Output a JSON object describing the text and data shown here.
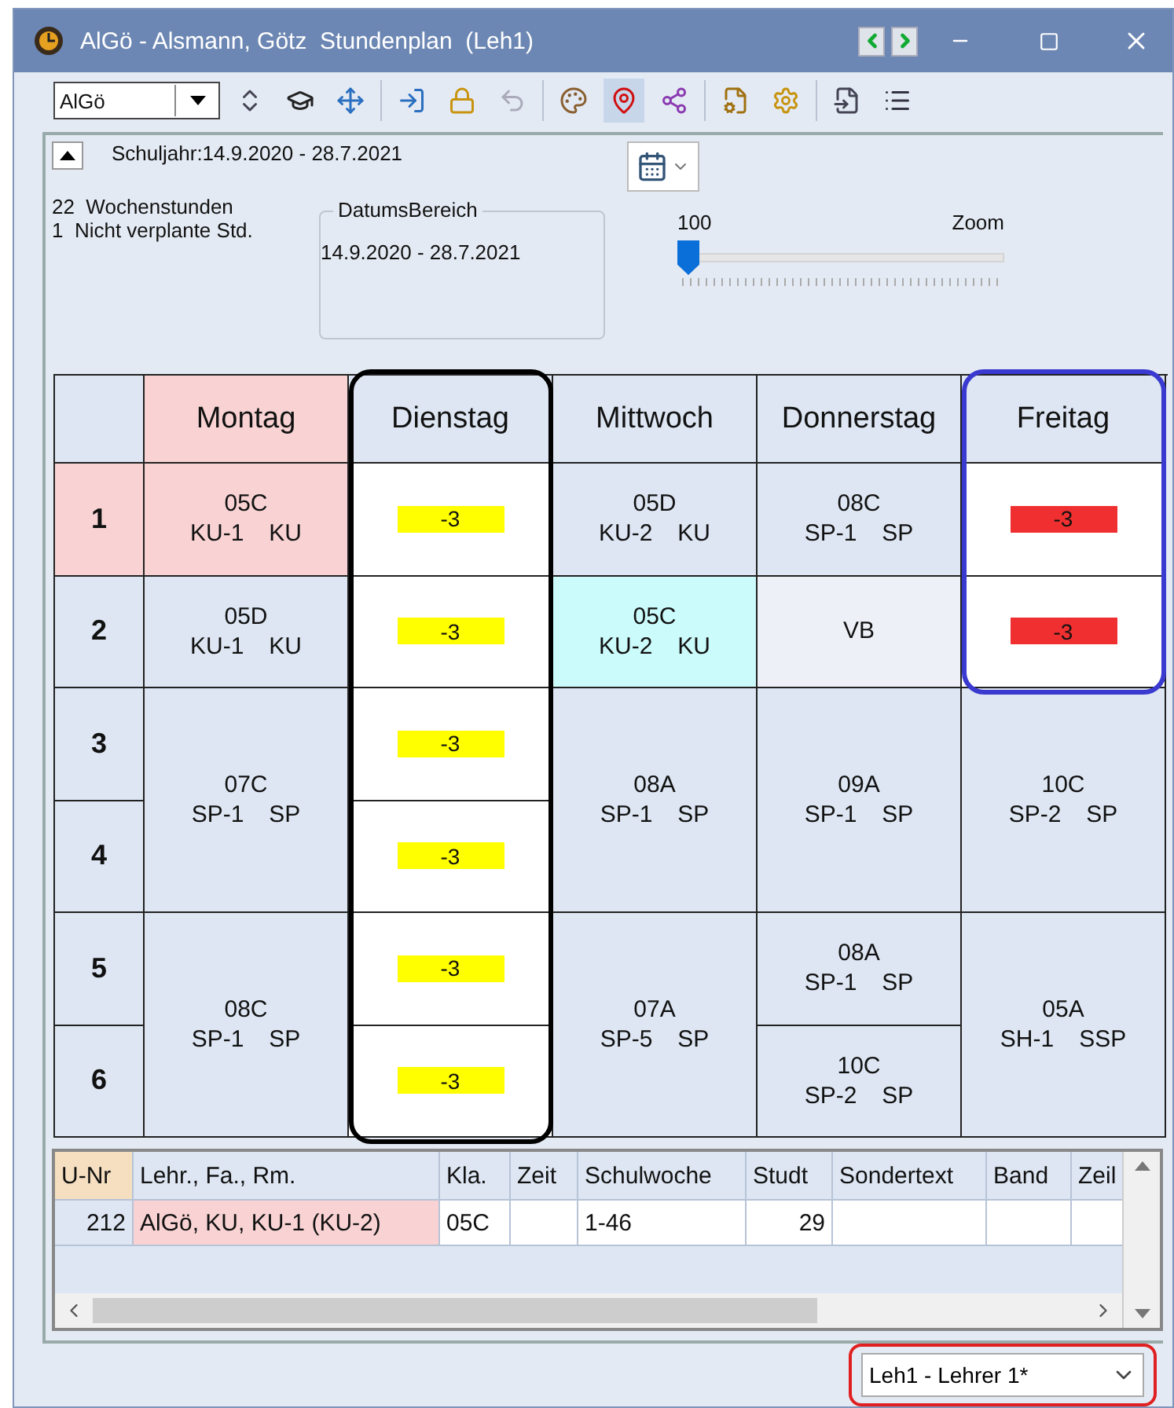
{
  "window": {
    "title": "AlGö - Alsmann, Götz  Stundenplan  (Leh1)"
  },
  "toolbar": {
    "element_field": "AlGö"
  },
  "info": {
    "school_year": "Schuljahr:14.9.2020 - 28.7.2021",
    "weekly_hours": "22  Wochenstunden",
    "unplanned": "1  Nicht verplante Std.",
    "date_range": {
      "legend": "DatumsBereich",
      "value": "14.9.2020 - 28.7.2021"
    },
    "zoom": {
      "value": "100",
      "label": "Zoom",
      "level": 0
    }
  },
  "periods": [
    {
      "label": "1",
      "color": "#f9d3d3"
    },
    {
      "label": "2",
      "color": "#dde6f2"
    },
    {
      "label": "3",
      "color": "#dde6f2"
    },
    {
      "label": "4",
      "color": "#dde6f2"
    },
    {
      "label": "5",
      "color": "#dde6f2"
    },
    {
      "label": "6",
      "color": "#dde6f2"
    }
  ],
  "days": [
    {
      "name": "Montag",
      "color": "#f9d3d3",
      "cells": [
        {
          "kind": "single",
          "color": "#f9d3d3",
          "class": "05C",
          "group": "KU-1",
          "subject": "KU"
        },
        {
          "kind": "single",
          "color": "#dde6f2",
          "class": "05D",
          "group": "KU-1",
          "subject": "KU"
        },
        {
          "kind": "double",
          "color": "#dde6f2",
          "class": "07C",
          "group": "SP-1",
          "subject": "SP"
        },
        {
          "kind": "double",
          "color": "#dde6f2",
          "class": "08C",
          "group": "SP-1",
          "subject": "SP"
        }
      ]
    },
    {
      "name": "Dienstag",
      "color": "#dde6f2",
      "outline": {
        "kind": "column",
        "color": "#000000"
      },
      "cells": [
        {
          "kind": "absence",
          "value": "-3",
          "color": "#ffff00"
        },
        {
          "kind": "absence",
          "value": "-3",
          "color": "#ffff00"
        },
        {
          "kind": "absence",
          "value": "-3",
          "color": "#ffff00"
        },
        {
          "kind": "absence",
          "value": "-3",
          "color": "#ffff00"
        },
        {
          "kind": "absence",
          "value": "-3",
          "color": "#ffff00"
        },
        {
          "kind": "absence",
          "value": "-3",
          "color": "#ffff00"
        }
      ]
    },
    {
      "name": "Mittwoch",
      "color": "#dde6f2",
      "cells": [
        {
          "kind": "single",
          "color": "#dde6f2",
          "class": "05D",
          "group": "KU-2",
          "subject": "KU"
        },
        {
          "kind": "single",
          "color": "#ccfbfb",
          "class": "05C",
          "group": "KU-2",
          "subject": "KU"
        },
        {
          "kind": "double",
          "color": "#dde6f2",
          "class": "08A",
          "group": "SP-1",
          "subject": "SP"
        },
        {
          "kind": "double",
          "color": "#dde6f2",
          "class": "07A",
          "group": "SP-5",
          "subject": "SP"
        }
      ]
    },
    {
      "name": "Donnerstag",
      "color": "#dde6f2",
      "cells": [
        {
          "kind": "single",
          "color": "#dde6f2",
          "class": "08C",
          "group": "SP-1",
          "subject": "SP"
        },
        {
          "kind": "single",
          "color": "#edf1f7",
          "class": "VB"
        },
        {
          "kind": "double",
          "color": "#dde6f2",
          "class": "09A",
          "group": "SP-1",
          "subject": "SP"
        },
        {
          "kind": "single",
          "color": "#dde6f2",
          "class": "08A",
          "group": "SP-1",
          "subject": "SP"
        },
        {
          "kind": "single",
          "color": "#dde6f2",
          "class": "10C",
          "group": "SP-2",
          "subject": "SP"
        }
      ]
    },
    {
      "name": "Freitag",
      "color": "#dde6f2",
      "outline": {
        "kind": "top",
        "color": "#3a3ad0"
      },
      "cells": [
        {
          "kind": "absence",
          "value": "-3",
          "color": "#f03030"
        },
        {
          "kind": "absence",
          "value": "-3",
          "color": "#f03030"
        },
        {
          "kind": "double",
          "color": "#dde6f2",
          "class": "10C",
          "group": "SP-2",
          "subject": "SP"
        },
        {
          "kind": "double",
          "color": "#dde6f2",
          "class": "05A",
          "group": "SH-1",
          "subject": "SSP"
        }
      ]
    }
  ],
  "table": {
    "columns": [
      {
        "label": "U-Nr",
        "color": "#f5dfc0"
      },
      {
        "label": "Lehr., Fa., Rm.",
        "color": "#dde6f2"
      },
      {
        "label": "Kla.",
        "color": "#dde6f2"
      },
      {
        "label": "Zeit",
        "color": "#dde6f2"
      },
      {
        "label": "Schulwoche",
        "color": "#dde6f2"
      },
      {
        "label": "Studt",
        "color": "#dde6f2"
      },
      {
        "label": "Sondertext",
        "color": "#dde6f2"
      },
      {
        "label": "Band",
        "color": "#dde6f2"
      },
      {
        "label": "Zeil",
        "color": "#dde6f2"
      }
    ],
    "rows": [
      {
        "cells": [
          {
            "text": "212",
            "color": "#dde6f2"
          },
          {
            "text": "AlGö, KU, KU-1 (KU-2)",
            "color": "#f9d3d3"
          },
          {
            "text": "05C",
            "color": "#ffffff"
          },
          {
            "text": "",
            "color": "#ffffff"
          },
          {
            "text": "1-46",
            "color": "#ffffff"
          },
          {
            "text": "29",
            "color": "#ffffff"
          },
          {
            "text": "",
            "color": "#ffffff"
          },
          {
            "text": "",
            "color": "#ffffff"
          },
          {
            "text": "",
            "color": "#ffffff"
          }
        ]
      }
    ]
  },
  "footer": {
    "view_select": "Leh1 - Lehrer 1*",
    "outline": {
      "color": "#e02020"
    }
  }
}
